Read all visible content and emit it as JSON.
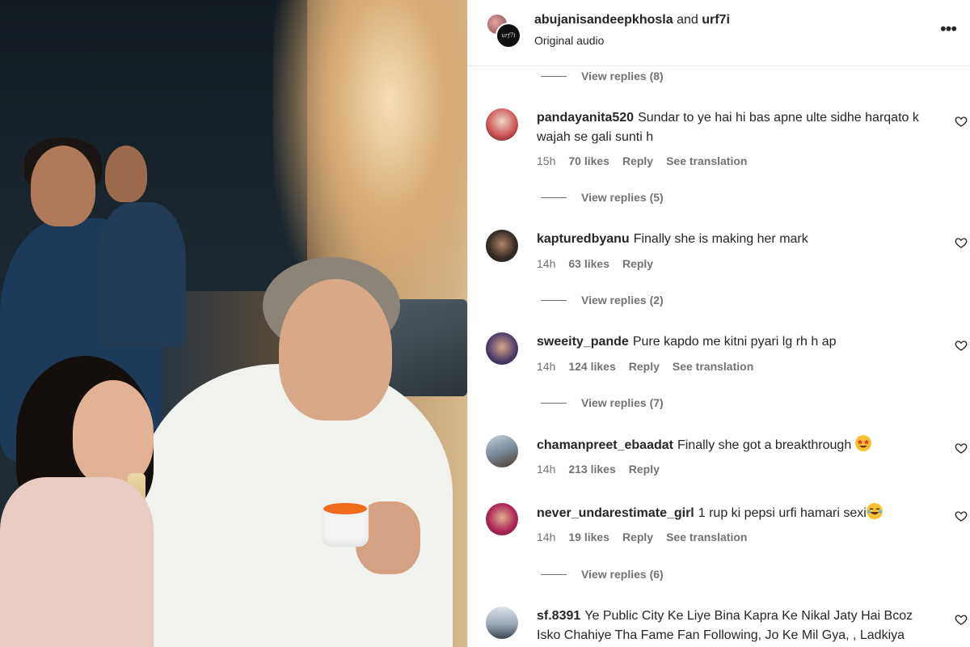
{
  "header": {
    "user1": "abujanisandeepkhosla",
    "and_text": "and",
    "user2": "urf7i",
    "subtitle": "Original audio",
    "more_label": "•••"
  },
  "view_replies": [
    {
      "label": "View replies (8)"
    },
    {
      "label": "View replies (5)"
    },
    {
      "label": "View replies (2)"
    },
    {
      "label": "View replies (7)"
    },
    {
      "label": "View replies (6)"
    }
  ],
  "comments": [
    {
      "username": "pandayanita520",
      "text": "Sundar to ye hai hi bas apne ulte sidhe harqato k wajah se gali sunti h",
      "time": "15h",
      "likes": "70 likes",
      "reply": "Reply",
      "translation": "See translation",
      "avatar_color": "#c94f4f"
    },
    {
      "username": "kapturedbyanu",
      "text": "Finally she is making her mark",
      "time": "14h",
      "likes": "63 likes",
      "reply": "Reply",
      "translation": "",
      "avatar_color": "#3a2e28"
    },
    {
      "username": "sweeity_pande",
      "text": "Pure kapdo me kitni pyari lg rh h ap",
      "time": "14h",
      "likes": "124 likes",
      "reply": "Reply",
      "translation": "See translation",
      "avatar_color": "#4a3a6a"
    },
    {
      "username": "chamanpreet_ebaadat",
      "text": "Finally she got a breakthrough",
      "emoji": "star-struck-emoji",
      "time": "14h",
      "likes": "213 likes",
      "reply": "Reply",
      "translation": "",
      "avatar_color": "#7a8a9a"
    },
    {
      "username": "never_undarestimate_girl",
      "text": "1 rup ki pepsi urfi hamari sexi",
      "emoji": "laughing-emoji",
      "time": "14h",
      "likes": "19 likes",
      "reply": "Reply",
      "translation": "See translation",
      "avatar_color": "#b02a5a"
    },
    {
      "username": "sf.8391",
      "text": "Ye Public City Ke Liye Bina Kapra Ke Nikal Jaty Hai Bcoz Isko Chahiye Tha Fame Fan Following, Jo Ke Mil Gya, , Ladkiya",
      "avatar_color": "#6a7a8a"
    }
  ],
  "icons": {
    "heart": "heart-outline-icon",
    "more": "more-horizontal-icon"
  }
}
